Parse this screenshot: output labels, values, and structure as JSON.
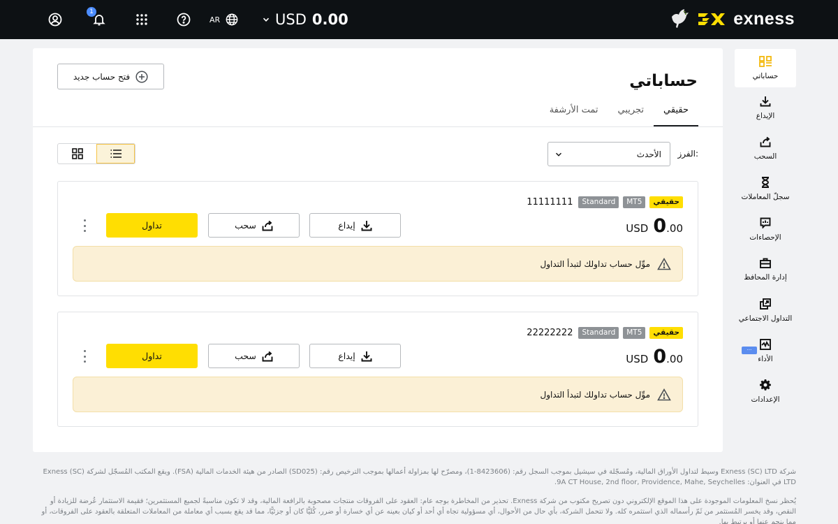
{
  "header": {
    "notification_count": "1",
    "language": "AR",
    "balance_currency": "USD",
    "balance_amount": "0.00",
    "logo_text": "exness",
    "icons": [
      "user-icon",
      "bell-icon",
      "apps-grid-icon",
      "help-icon",
      "globe-icon",
      "chevron-down-icon"
    ]
  },
  "sidebar": {
    "items": [
      {
        "label": "حساباتي",
        "icon": "accounts-icon",
        "active": true
      },
      {
        "label": "الإيداع",
        "icon": "deposit-icon"
      },
      {
        "label": "السحب",
        "icon": "withdraw-icon"
      },
      {
        "label": "سجلّ المعاملات",
        "icon": "hourglass-icon"
      },
      {
        "label": "الإحصاءات",
        "icon": "statistics-icon"
      },
      {
        "label": "إدارة المحافظ",
        "icon": "briefcase-icon"
      },
      {
        "label": "التداول الاجتماعي",
        "icon": "social-trading-icon"
      },
      {
        "label": "الأداء",
        "icon": "performance-icon"
      },
      {
        "label": "الإعدادات",
        "icon": "settings-icon"
      }
    ]
  },
  "main": {
    "title": "حساباتي",
    "new_account_label": "فتح حساب جديد",
    "tabs": [
      {
        "label": "حقيقي",
        "active": true
      },
      {
        "label": "تجريبي"
      },
      {
        "label": "تمت الأرشفة"
      }
    ],
    "sort": {
      "label": "الفرز:",
      "value": "الأحدث"
    },
    "view": {
      "active": "list"
    }
  },
  "accounts": [
    {
      "type": "حقيقي",
      "platform": "MT5",
      "account_type": "Standard",
      "number": "11111111",
      "currency": "USD",
      "balance_int": "0",
      "balance_dec": ".00",
      "deposit_label": "إيداع",
      "withdraw_label": "سحب",
      "trade_label": "تداول",
      "notice": "موِّل حساب تداولك لتبدأ التداول"
    },
    {
      "type": "حقيقي",
      "platform": "MT5",
      "account_type": "Standard",
      "number": "22222222",
      "currency": "USD",
      "balance_int": "0",
      "balance_dec": ".00",
      "deposit_label": "إيداع",
      "withdraw_label": "سحب",
      "trade_label": "تداول",
      "notice": "موِّل حساب تداولك لتبدأ التداول"
    }
  ],
  "footer": {
    "p1": "شركة Exness (SC) LTD وسيط لتداول الأوراق المالية، ومُسجّلة في سيشيل بموجب السجل رقم: (8423606-1)، ومصرّح لها بمزاولة أعمالها بموجب الترخيص رقم: (SD025) الصادر من هيئة الخدمات المالية (FSA). ويقع المكتب المُسجّل لشركة Exness (SC) LTD في العنوان: 9A CT House, 2nd floor, Providence, Mahe, Seychelles.",
    "p2": "يُحظر نسخ المعلومات الموجودة على هذا الموقع الإلكتروني دون تصريح مكتوب من شركة Exness. تحذير من المخاطرة بوجه عام: العقود على الفروقات منتجات مصحوبة بالرافعة المالية، وقد لا تكون مناسبةً لجميع المستثمرين؛ فقيمة الاستثمار عُرضة للزيادة أو النقص، وقد يخسر المُستثمر من ثَمّ رأسماله الذي استثمره كله. ولا تتحمل الشركة، بأي حال من الأحوال، أي مسؤولية تجاه أي أحد أو كيان بعينه عن أي خسارة أو ضرر، كُليًّا كان أو جزئيًّا، مما قد يقع بسبب أي معاملة من المعاملات المتعلقة بالعقود على الفروقات، أو مما ينجم عنها أو يرتبط بها."
  },
  "colors": {
    "accent_yellow": "#ffde02",
    "topbar": "#0d1114",
    "notice_bg": "#fbf0d6",
    "badge_blue": "#4c8dff"
  }
}
